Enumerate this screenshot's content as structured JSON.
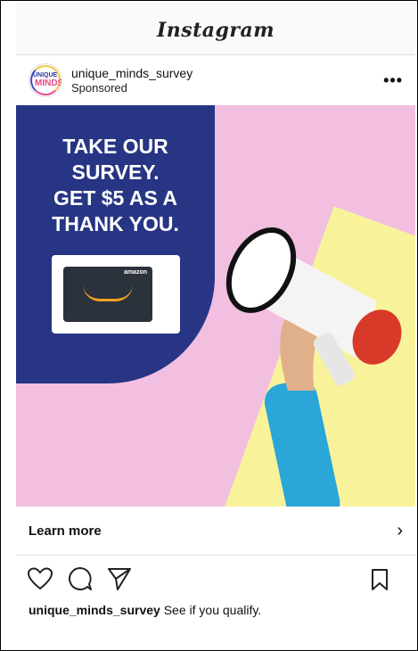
{
  "app": {
    "wordmark": "Instagram"
  },
  "post": {
    "username": "unique_minds_survey",
    "sponsored_label": "Sponsored",
    "more_icon": "more-options-icon",
    "avatar_text_top": "UNIQUE",
    "avatar_text_bottom": "MINDS"
  },
  "ad": {
    "headline_lines": [
      "TAKE OUR",
      "SURVEY.",
      "GET $5 AS A",
      "THANK YOU."
    ],
    "card_brand": "amazon",
    "colors": {
      "background": "#f2bfe0",
      "panel": "#273584",
      "accent": "#f8f39a"
    }
  },
  "cta": {
    "label": "Learn more",
    "chevron": "›"
  },
  "actions": {
    "like_icon": "heart-icon",
    "comment_icon": "comment-icon",
    "share_icon": "share-icon",
    "save_icon": "bookmark-icon"
  },
  "caption": {
    "username": "unique_minds_survey",
    "text": "See if you qualify."
  }
}
